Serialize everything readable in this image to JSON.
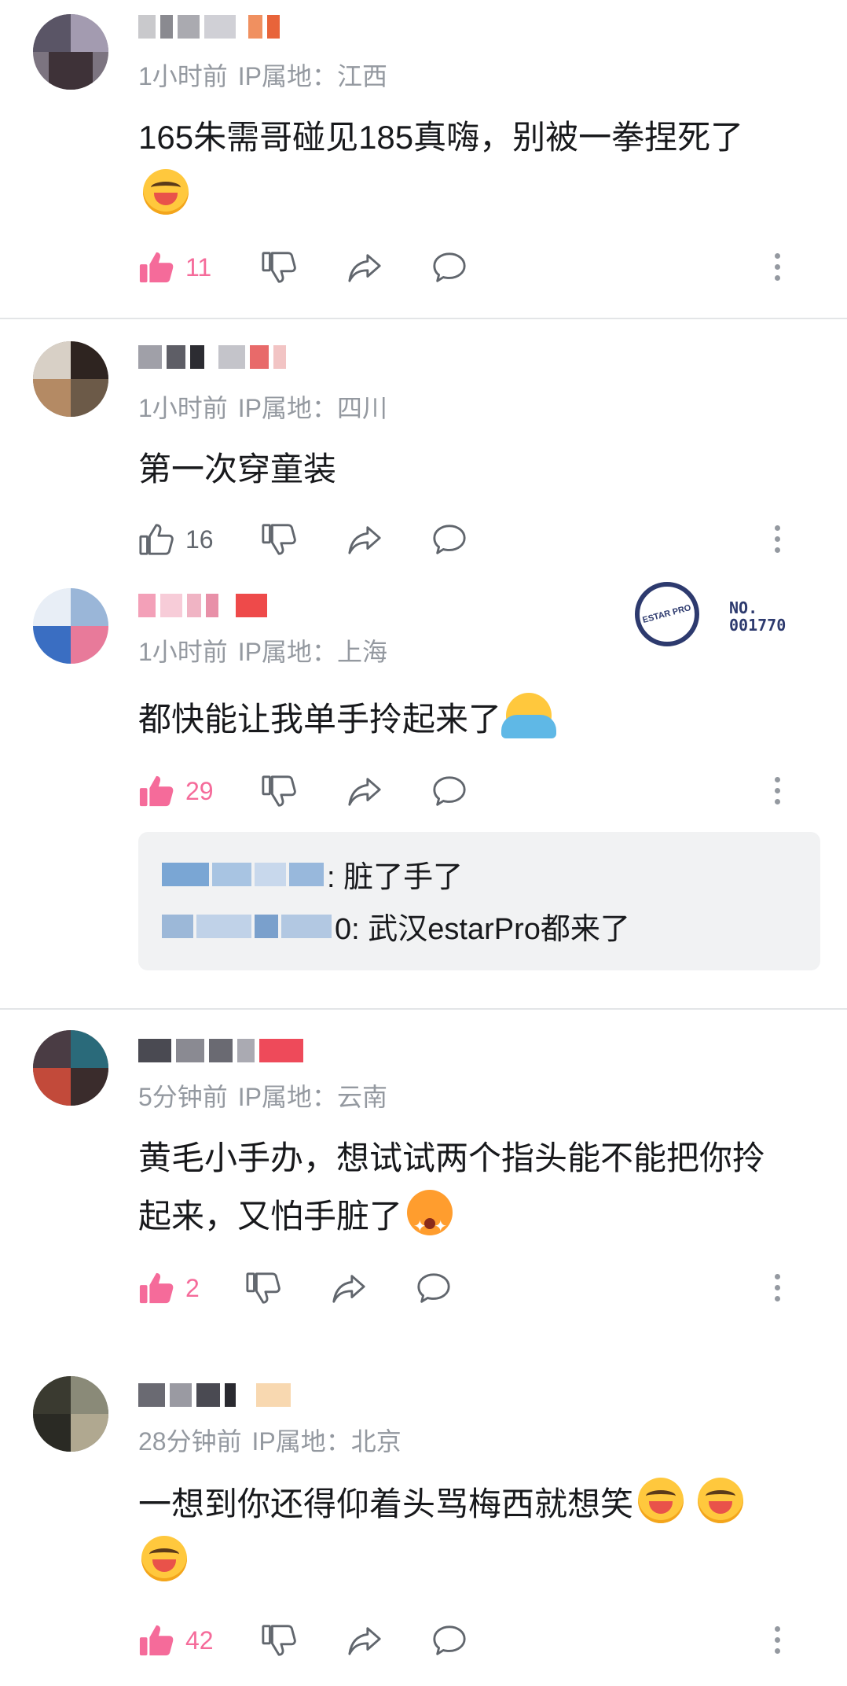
{
  "comments": [
    {
      "meta_time": "1小时前",
      "meta_ip": "IP属地：江西",
      "text": "165朱需哥碰见185真嗨，别被一拳捏死了",
      "emojis": [
        "laugh-emoji"
      ],
      "likes": "11",
      "liked": true
    },
    {
      "meta_time": "1小时前",
      "meta_ip": "IP属地：四川",
      "text": "第一次穿童装",
      "emojis": [],
      "likes": "16",
      "liked": false
    },
    {
      "meta_time": "1小时前",
      "meta_ip": "IP属地：上海",
      "text": "都快能让我单手拎起来了",
      "emojis": [
        "shrug-emoji"
      ],
      "likes": "29",
      "liked": true,
      "badge": {
        "label": "ESTAR PRO",
        "number_line1": "NO.",
        "number_line2": "001770"
      },
      "replies": [
        {
          "text": ": 脏了手了"
        },
        {
          "text": "0: 武汉estarPro都来了"
        }
      ]
    },
    {
      "meta_time": "5分钟前",
      "meta_ip": "IP属地：云南",
      "text_line1": "黄毛小手办，想试试两个指头能不能把你拎",
      "text_line2": "起来，又怕手脏了",
      "emojis": [
        "starstruck-emoji"
      ],
      "likes": "2",
      "liked": true
    },
    {
      "meta_time": "28分钟前",
      "meta_ip": "IP属地：北京",
      "text": "一想到你还得仰着头骂梅西就想笑",
      "emojis": [
        "laugh-emoji",
        "laugh-emoji",
        "laugh-emoji"
      ],
      "likes": "42",
      "liked": true
    }
  ],
  "colors": {
    "accent": "#f56b9a",
    "muted": "#9499a0",
    "text": "#18191c",
    "reply_bg": "#f1f2f3"
  },
  "icons": [
    "thumbs-up-icon",
    "thumbs-down-icon",
    "share-icon",
    "reply-icon",
    "more-icon"
  ]
}
